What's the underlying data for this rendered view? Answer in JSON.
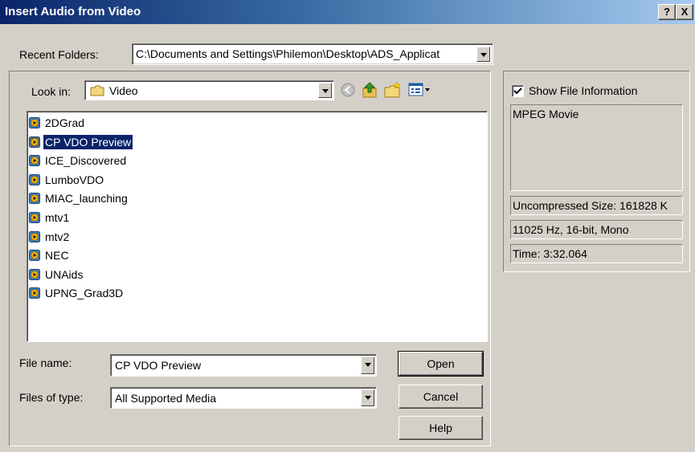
{
  "dialog": {
    "title": "Insert Audio from Video",
    "help_button": "?",
    "close_button": "X"
  },
  "recent_folders": {
    "label": "Recent Folders:",
    "value": "C:\\Documents and Settings\\Philemon\\Desktop\\ADS_Applicat"
  },
  "look_in": {
    "label": "Look in:",
    "value": "Video"
  },
  "toolbar": {
    "back_icon": "back-arrow-icon",
    "up_icon": "up-folder-icon",
    "new_folder_icon": "new-folder-icon",
    "view_icon": "view-menu-icon"
  },
  "files": [
    {
      "name": "2DGrad",
      "selected": false
    },
    {
      "name": "CP VDO Preview",
      "selected": true
    },
    {
      "name": "ICE_Discovered",
      "selected": false
    },
    {
      "name": "LumboVDO",
      "selected": false
    },
    {
      "name": "MIAC_launching",
      "selected": false
    },
    {
      "name": "mtv1",
      "selected": false
    },
    {
      "name": "mtv2",
      "selected": false
    },
    {
      "name": "NEC",
      "selected": false
    },
    {
      "name": "UNAids",
      "selected": false
    },
    {
      "name": "UPNG_Grad3D",
      "selected": false
    }
  ],
  "file_name": {
    "label": "File name:",
    "value": "CP VDO Preview"
  },
  "file_type": {
    "label": "Files of type:",
    "value": "All Supported Media"
  },
  "buttons": {
    "open": "Open",
    "cancel": "Cancel",
    "help": "Help"
  },
  "info_panel": {
    "show_info_label": "Show File Information",
    "show_info_checked": true,
    "description": "MPEG Movie",
    "uncompressed_size": "Uncompressed Size: 161828 K",
    "format": "11025 Hz, 16-bit, Mono",
    "time": "Time: 3:32.064"
  }
}
